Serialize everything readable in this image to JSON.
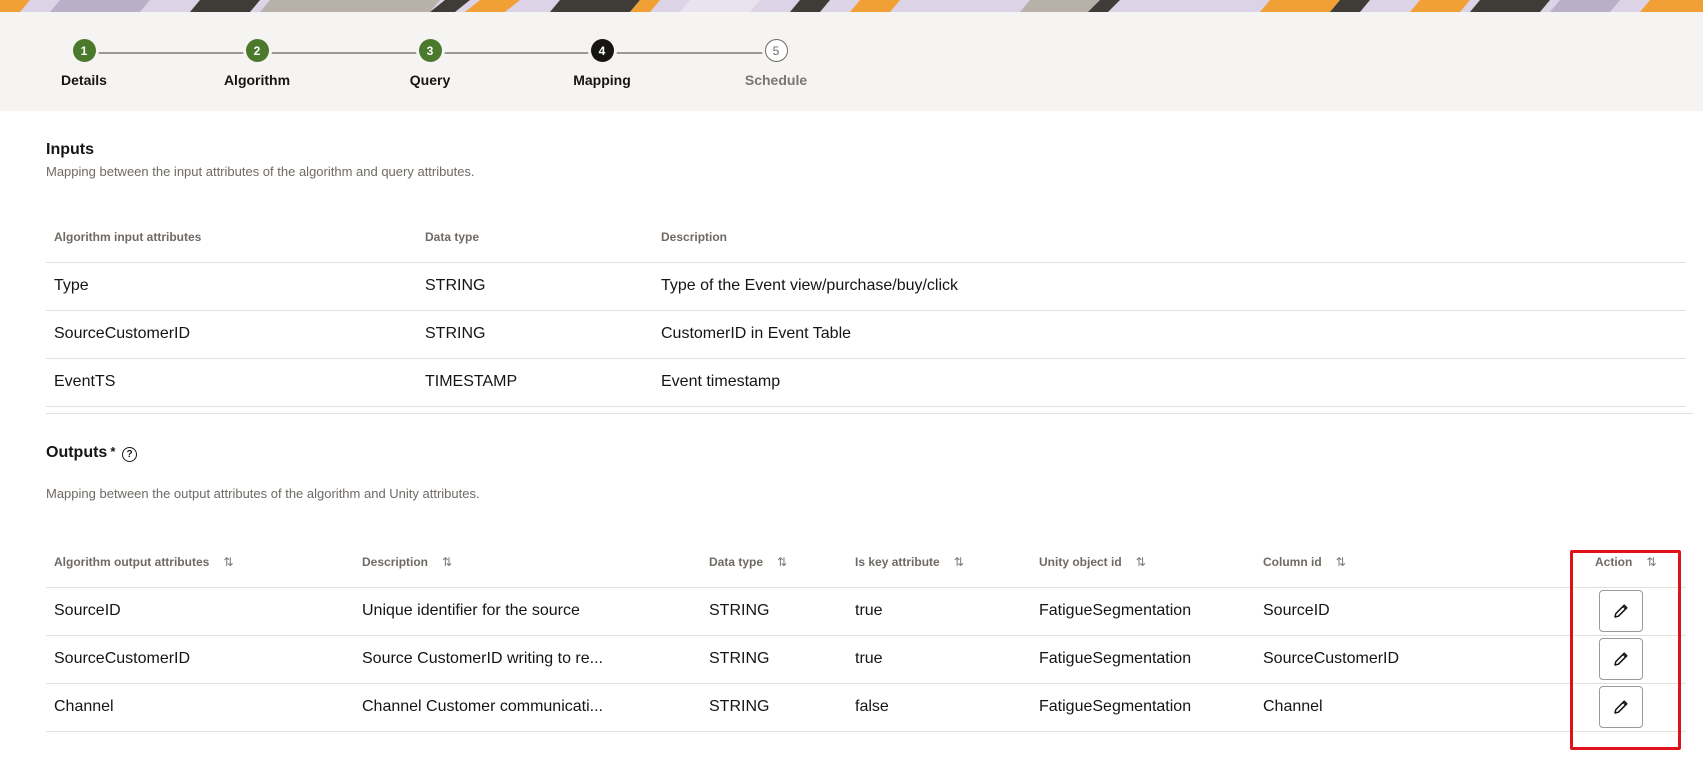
{
  "train": {
    "steps": [
      {
        "number": "1",
        "label": "Details",
        "state": "done"
      },
      {
        "number": "2",
        "label": "Algorithm",
        "state": "done"
      },
      {
        "number": "3",
        "label": "Query",
        "state": "done"
      },
      {
        "number": "4",
        "label": "Mapping",
        "state": "current"
      },
      {
        "number": "5",
        "label": "Schedule",
        "state": "todo"
      }
    ]
  },
  "inputs": {
    "title": "Inputs",
    "subtitle": "Mapping between the input attributes of the algorithm and query attributes.",
    "columns": [
      "Algorithm input attributes",
      "Data type",
      "Description"
    ],
    "rows": [
      {
        "attribute": "Type",
        "data_type": "STRING",
        "description": "Type of the Event view/purchase/buy/click"
      },
      {
        "attribute": "SourceCustomerID",
        "data_type": "STRING",
        "description": "CustomerID in Event Table"
      },
      {
        "attribute": "EventTS",
        "data_type": "TIMESTAMP",
        "description": "Event timestamp"
      }
    ]
  },
  "outputs": {
    "title": "Outputs",
    "required_marker": "*",
    "help_icon_glyph": "?",
    "subtitle": "Mapping between the output attributes of the algorithm and Unity attributes.",
    "columns": [
      "Algorithm output attributes",
      "Description",
      "Data type",
      "Is key attribute",
      "Unity object id",
      "Column id",
      "Action"
    ],
    "sort_glyph": "⇅",
    "rows": [
      {
        "attribute": "SourceID",
        "description": "Unique identifier for the source",
        "data_type": "STRING",
        "is_key": "true",
        "unity_object_id": "FatigueSegmentation",
        "column_id": "SourceID"
      },
      {
        "attribute": "SourceCustomerID",
        "description": "Source CustomerID writing to re...",
        "data_type": "STRING",
        "is_key": "true",
        "unity_object_id": "FatigueSegmentation",
        "column_id": "SourceCustomerID"
      },
      {
        "attribute": "Channel",
        "description": "Channel Customer communicati...",
        "data_type": "STRING",
        "is_key": "false",
        "unity_object_id": "FatigueSegmentation",
        "column_id": "Channel"
      }
    ]
  },
  "colors": {
    "step_done": "#4b7a2d",
    "step_current": "#161513",
    "highlight_box": "#e0111b"
  },
  "icons": {
    "edit": "pencil-icon",
    "sort": "sort-icon",
    "help": "help-icon"
  }
}
